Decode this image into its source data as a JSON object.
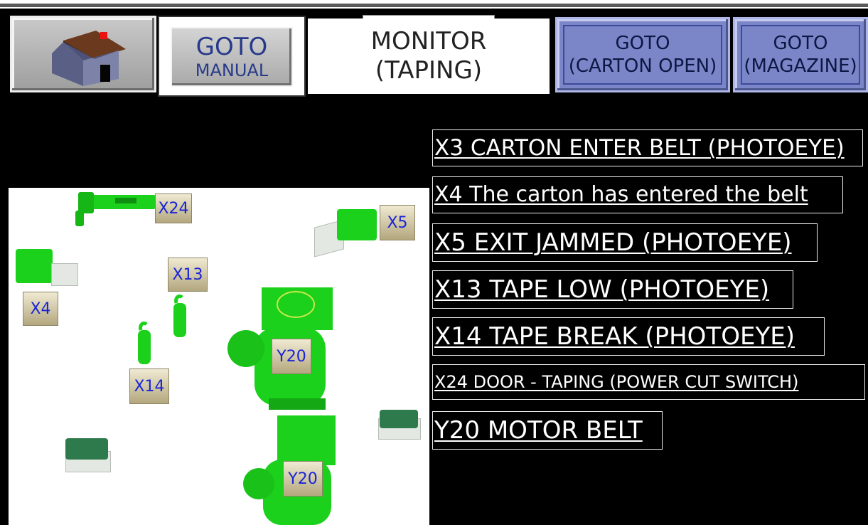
{
  "header": {
    "home_icon": "house-icon",
    "manual_button": {
      "line1": "GOTO",
      "line2": "MANUAL"
    },
    "title": {
      "line1": "MONITOR",
      "line2": "(TAPING)"
    },
    "carton_open_button": {
      "line1": "GOTO",
      "line2": "(CARTON OPEN)"
    },
    "magazine_button": {
      "line1": "GOTO",
      "line2": "(MAGAZINE)"
    }
  },
  "diagram": {
    "tags": {
      "x24": "X24",
      "x5": "X5",
      "x13": "X13",
      "x4": "X4",
      "x14": "X14",
      "y20_top": "Y20",
      "y20_bottom": "Y20"
    }
  },
  "io_list": [
    {
      "text": "X3 CARTON ENTER BELT (PHOTOEYE)"
    },
    {
      "text": "X4  The carton has entered the belt"
    },
    {
      "text": "X5 EXIT JAMMED (PHOTOEYE)"
    },
    {
      "text": "X13 TAPE LOW (PHOTOEYE)"
    },
    {
      "text": "X14 TAPE BREAK (PHOTOEYE)"
    },
    {
      "text": "X24 DOOR - TAPING (POWER CUT SWITCH)"
    },
    {
      "text": "Y20 MOTOR BELT"
    }
  ],
  "colors": {
    "sensor_green": "#1bd11b",
    "tag_text": "#1a24d6",
    "button_blue": "#7b86c8"
  }
}
